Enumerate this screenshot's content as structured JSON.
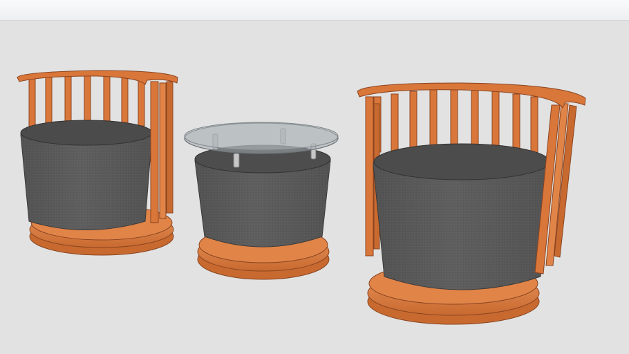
{
  "scene": {
    "background": "#e2e2e2",
    "sky": "#f2f4f6",
    "wood": "#d9763a",
    "wood_dark": "#a9542a",
    "wood_light": "#e79a62",
    "fabric": "#5a5a5a",
    "fabric_top": "#4f4f4f",
    "fabric_dark": "#3e3e3e",
    "glass": "#9ea6aa"
  },
  "objects": [
    {
      "name": "left-barrel-chair",
      "kind": "armchair",
      "icon": "chair-icon"
    },
    {
      "name": "glass-top-ottoman-table",
      "kind": "side-table",
      "icon": "table-icon"
    },
    {
      "name": "right-barrel-chair",
      "kind": "armchair",
      "icon": "chair-icon"
    }
  ]
}
